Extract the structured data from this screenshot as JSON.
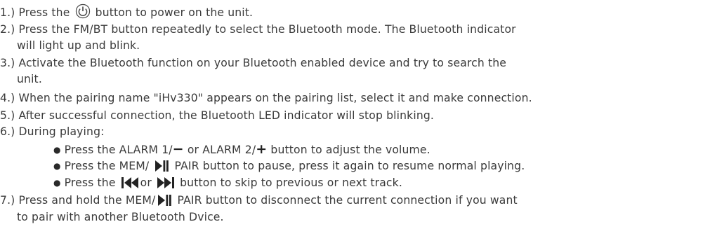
{
  "steps": {
    "s1": {
      "a": "1.)  Press  the ",
      "b": " button  to power on the unit."
    },
    "s2": {
      "line1": "2.)  Press the FM/BT button  repeatedly to select the Bluetooth mode. The Bluetooth indicator",
      "line2": "will light up and blink."
    },
    "s3": {
      "line1": "3.)  Activate the Bluetooth function on your Bluetooth enabled device and try to search the",
      "line2": "unit."
    },
    "s4": {
      "line1": "4.)  When the pairing name \"iHv330\" appears on the pairing list, select it and make connection."
    },
    "s5": {
      "line1": "5.)  After successful connection, the Bluetooth LED indicator will stop blinking."
    },
    "s6": {
      "line1": "6.)  During playing:",
      "b1": {
        "a": "Press the ALARM 1/",
        "minus": "−",
        "b": "   or ALARM 2/",
        "plus": "+",
        "c": "  button to adjust the volume."
      },
      "b2": {
        "a": "Press the MEM/ ",
        "b": " PAIR button to pause, press it again to resume normal playing."
      },
      "b3": {
        "a": "Press the ",
        "b": "or ",
        "c": "  button to skip to previous or next track."
      }
    },
    "s7": {
      "a": "7.)  Press and hold the MEM/",
      "b": " PAIR button to disconnect the current connection if you want",
      "line2": "to pair with another Bluetooth Dvice."
    }
  },
  "bullet_glyph": "●",
  "icons": [
    "power-icon",
    "play-pause-icon",
    "previous-track-icon",
    "next-track-icon"
  ]
}
